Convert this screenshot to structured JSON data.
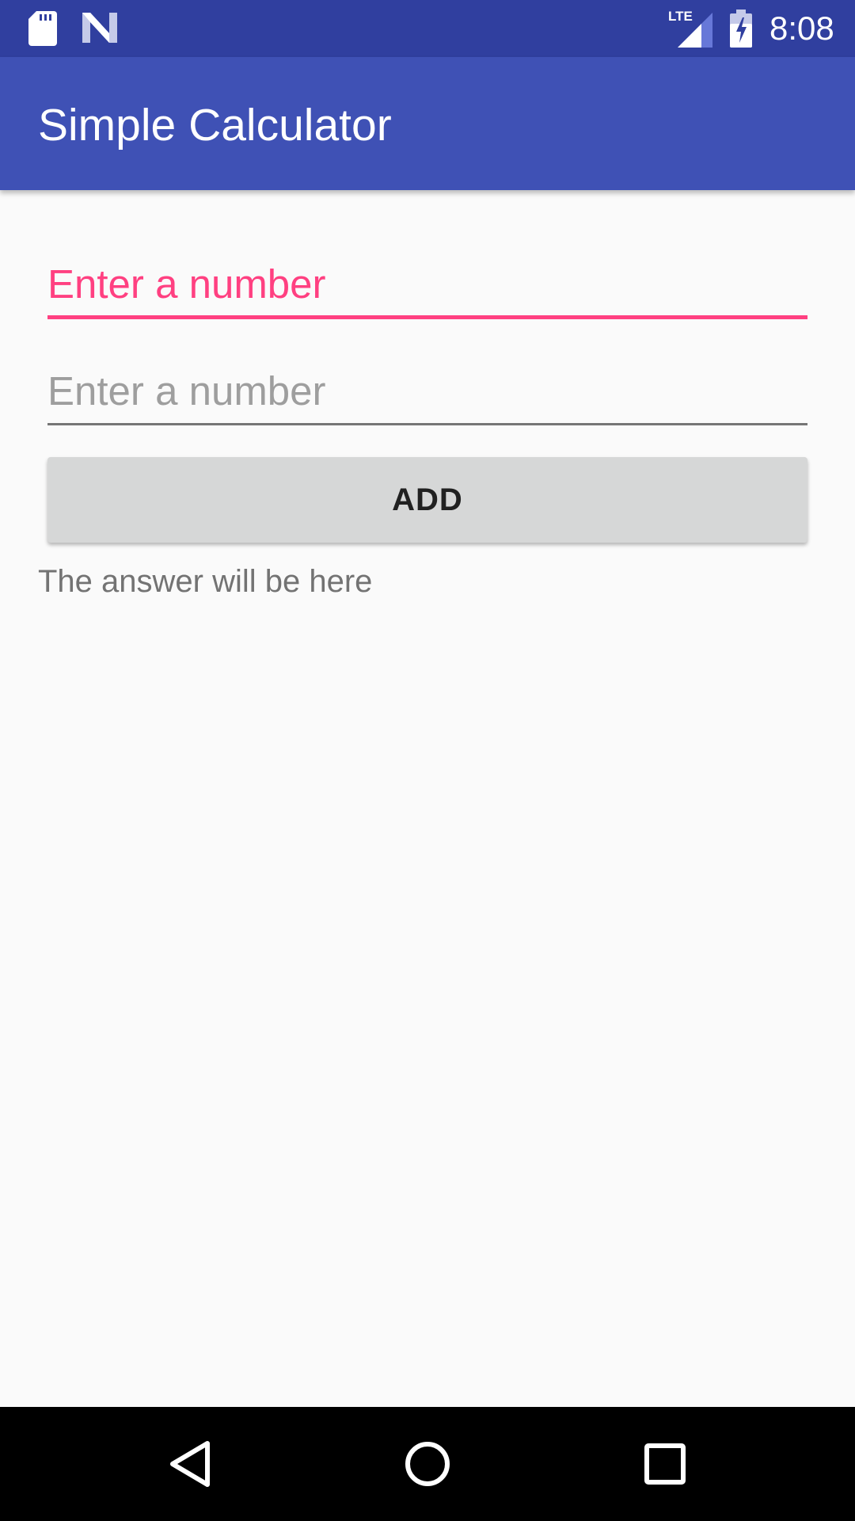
{
  "status_bar": {
    "time": "8:08",
    "network": "LTE",
    "icons": [
      "sd-card-icon",
      "n-notification-icon",
      "lte-signal-icon",
      "battery-charging-icon"
    ]
  },
  "app_bar": {
    "title": "Simple Calculator",
    "color": "#3f51b5"
  },
  "form": {
    "first_number": {
      "value": "",
      "placeholder": "Enter a number",
      "focused": true
    },
    "second_number": {
      "value": "",
      "placeholder": "Enter a number",
      "focused": false
    },
    "add_label": "ADD",
    "answer": "The answer will be here"
  },
  "colors": {
    "status_bar": "#303f9f",
    "accent": "#ff4081",
    "background": "#fafafa"
  },
  "nav_bar": {
    "buttons": [
      "back-icon",
      "home-icon",
      "recents-icon"
    ]
  }
}
